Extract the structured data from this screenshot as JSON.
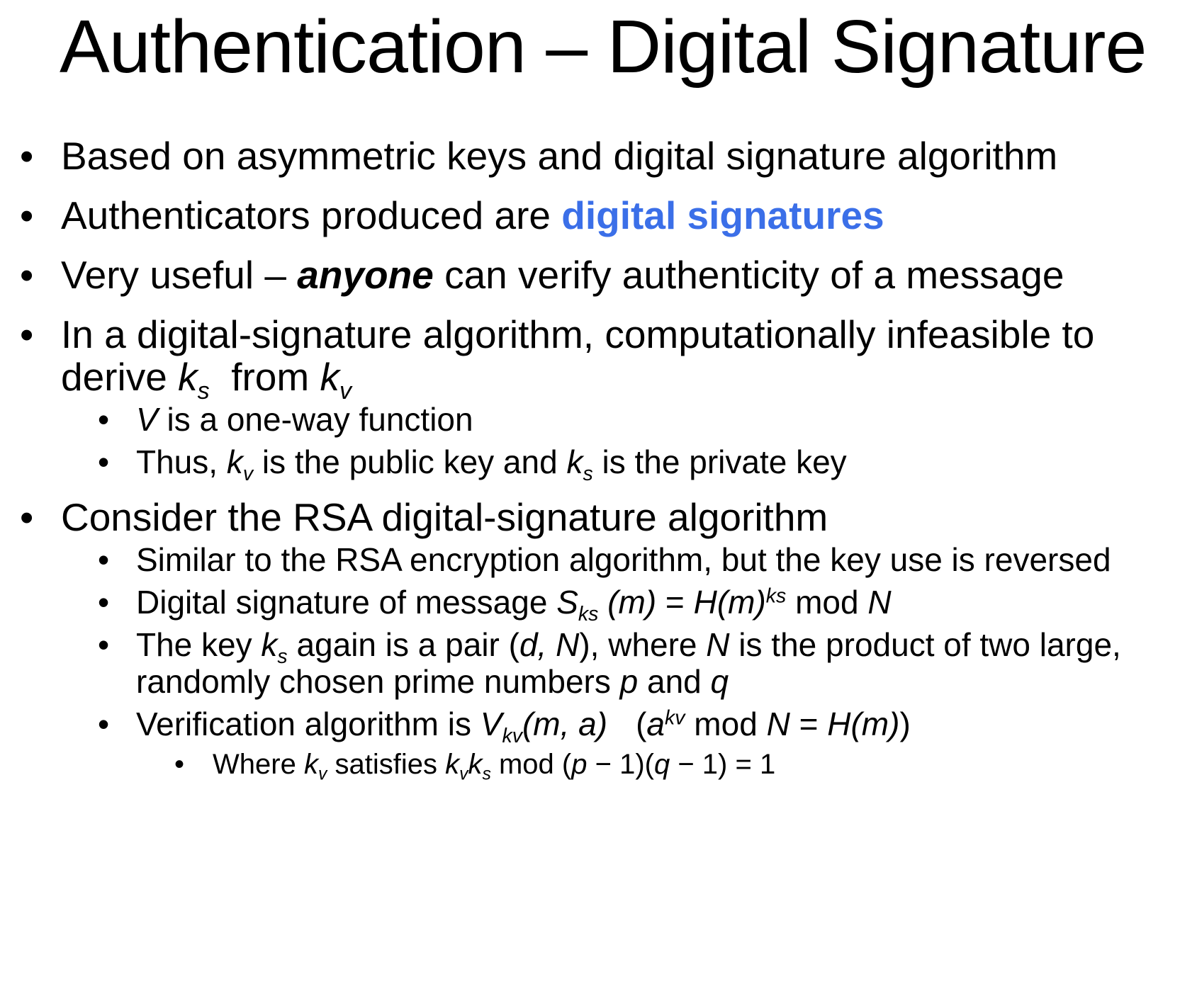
{
  "slide": {
    "title": "Authentication – Digital Signature",
    "bullets": {
      "b1": {
        "text": "Based on asymmetric keys and digital signature algorithm"
      },
      "b2": {
        "pre": "Authenticators produced are ",
        "highlight": "digital signatures"
      },
      "b3": {
        "pre": "Very useful – ",
        "emph": "anyone",
        "post": " can verify authenticity of a message"
      },
      "b4": {
        "pre": "In a digital-signature algorithm, computationally infeasible to derive ",
        "k": "k",
        "s": "s",
        "mid": "  from ",
        "v": "v",
        "sub": {
          "s1": {
            "V": "V",
            "text": " is a one-way function"
          },
          "s2": {
            "pre": "Thus, ",
            "mid": " is the public key and ",
            "post": " is the private key"
          }
        }
      },
      "b5": {
        "text": "Consider the RSA digital-signature algorithm",
        "sub": {
          "s1": {
            "text": "Similar to the RSA encryption algorithm, but the key use is reversed"
          },
          "s2": {
            "pre": "Digital signature of message ",
            "S": "S",
            "ks": "ks",
            "m_paren": " (m)",
            "eq": " = ",
            "H": "H",
            "m2": "(m)",
            "exp": "ks",
            "post_mod": " mod ",
            "N": "N"
          },
          "s3": {
            "pre": "The key ",
            "mid": " again is a pair (",
            "dN": "d, N",
            "close": "), where ",
            "N": "N",
            "mid2": " is the product of two large, randomly chosen prime numbers ",
            "p": "p",
            "and": " and ",
            "q": "q"
          },
          "s4": {
            "pre": "Verification algorithm is ",
            "V": "V",
            "kv": "kv",
            "args": "(m, a)",
            "open": "(",
            "a": "a",
            "exp": "kv",
            "mod": " mod ",
            "N": "N",
            "eq": " = ",
            "H": "H",
            "m": "(m)",
            "close": ")",
            "sub": {
              "t1": {
                "pre": "Where ",
                "mid": " satisfies ",
                "post": " mod (",
                "p": "p",
                "minus1": " − 1)(",
                "q": "q",
                "minus2": " − 1) = 1"
              }
            }
          }
        }
      }
    }
  }
}
